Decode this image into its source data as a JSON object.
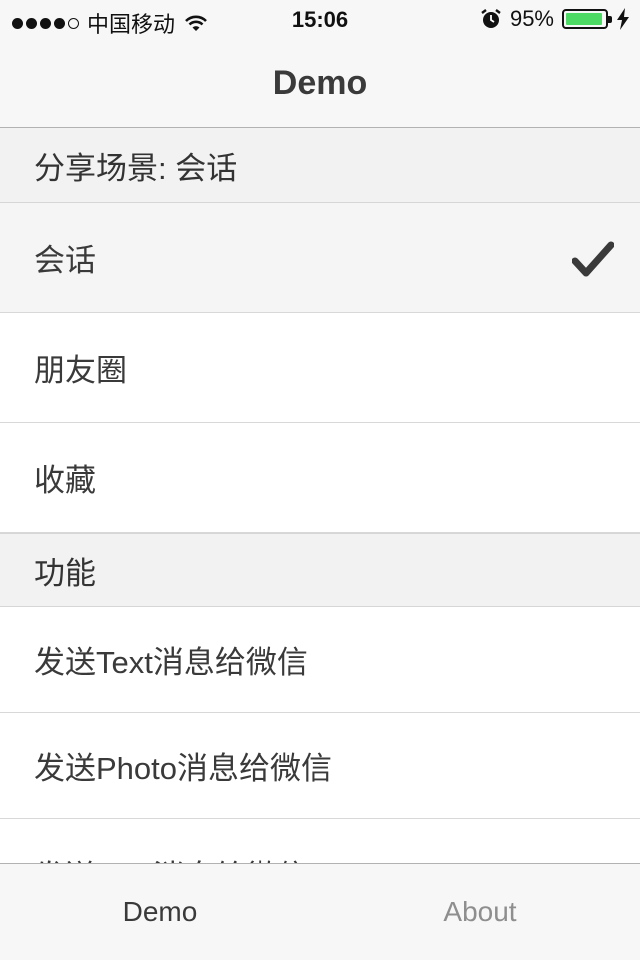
{
  "status_bar": {
    "carrier": "中国移动",
    "time": "15:06",
    "battery_percent": "95%",
    "battery_level": 0.95,
    "battery_color": "#4cd964",
    "signal_dots_filled": 4,
    "signal_dots_total": 5
  },
  "nav": {
    "title": "Demo"
  },
  "scene_section": {
    "header": "分享场景: 会话",
    "items": [
      {
        "label": "会话",
        "selected": true
      },
      {
        "label": "朋友圈",
        "selected": false
      },
      {
        "label": "收藏",
        "selected": false
      }
    ]
  },
  "function_section": {
    "header": "功能",
    "items": [
      {
        "label": "发送Text消息给微信"
      },
      {
        "label": "发送Photo消息给微信"
      },
      {
        "label": "发送Link消息给微信"
      }
    ]
  },
  "tab_bar": {
    "tabs": [
      {
        "label": "Demo",
        "active": true
      },
      {
        "label": "About",
        "active": false
      }
    ]
  },
  "icons": {
    "wifi": "wifi-icon",
    "alarm": "alarm-clock-icon",
    "charging": "charging-bolt-icon",
    "checkmark": "checkmark-icon"
  }
}
